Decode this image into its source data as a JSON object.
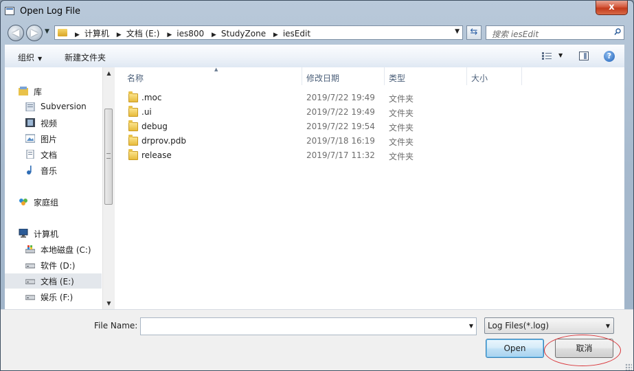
{
  "window": {
    "title": "Open Log File",
    "close_label": "x"
  },
  "nav": {
    "back_label": "◀",
    "forward_label": "▶",
    "breadcrumbs": [
      "计算机",
      "文档 (E:)",
      "ies800",
      "StudyZone",
      "iesEdit"
    ],
    "search_placeholder": "搜索 iesEdit"
  },
  "toolbar": {
    "organize_label": "组织",
    "new_folder_label": "新建文件夹"
  },
  "sidebar": {
    "items": [
      {
        "label": "库",
        "icon": "library-icon"
      },
      {
        "label": "Subversion",
        "icon": "subversion-icon"
      },
      {
        "label": "视频",
        "icon": "video-icon"
      },
      {
        "label": "图片",
        "icon": "picture-icon"
      },
      {
        "label": "文档",
        "icon": "document-icon"
      },
      {
        "label": "音乐",
        "icon": "music-icon"
      },
      {
        "label": "家庭组",
        "icon": "homegroup-icon"
      },
      {
        "label": "计算机",
        "icon": "computer-icon"
      },
      {
        "label": "本地磁盘 (C:)",
        "icon": "system-drive-icon"
      },
      {
        "label": "软件 (D:)",
        "icon": "drive-icon"
      },
      {
        "label": "文档 (E:)",
        "icon": "drive-icon",
        "selected": true
      },
      {
        "label": "娱乐 (F:)",
        "icon": "drive-icon"
      }
    ]
  },
  "columns": {
    "name": "名称",
    "modified": "修改日期",
    "type": "类型",
    "size": "大小"
  },
  "files": [
    {
      "name": ".moc",
      "modified": "2019/7/22 19:49",
      "type": "文件夹"
    },
    {
      "name": ".ui",
      "modified": "2019/7/22 19:49",
      "type": "文件夹"
    },
    {
      "name": "debug",
      "modified": "2019/7/22 19:54",
      "type": "文件夹"
    },
    {
      "name": "drprov.pdb",
      "modified": "2019/7/18 16:19",
      "type": "文件夹"
    },
    {
      "name": "release",
      "modified": "2019/7/17 11:32",
      "type": "文件夹"
    }
  ],
  "footer": {
    "file_name_label": "File Name:",
    "file_name_value": "",
    "file_type": "Log Files(*.log)",
    "open_label": "Open",
    "cancel_label": "取消"
  },
  "colors": {
    "accent": "#3c7fb1",
    "annotation_circle": "#d9363a"
  }
}
